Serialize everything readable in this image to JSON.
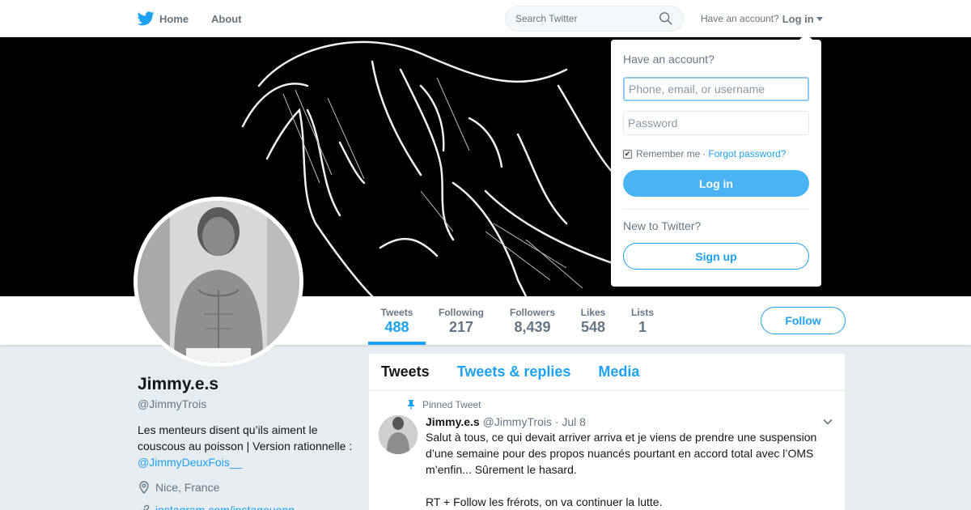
{
  "nav": {
    "home_label": "Home",
    "about_label": "About",
    "search_placeholder": "Search Twitter",
    "have_account": "Have an account?",
    "login_label": "Log in"
  },
  "profile": {
    "name": "Jimmy.e.s",
    "handle": "@JimmyTrois",
    "bio_text": "Les menteurs disent qu’ils aiment le couscous au poisson | Version rationnelle : ",
    "bio_link": "@JimmyDeuxFois__",
    "location": "Nice, France",
    "website": "instagram.com/instagouenn"
  },
  "stats": [
    {
      "label": "Tweets",
      "value": "488",
      "active": true
    },
    {
      "label": "Following",
      "value": "217"
    },
    {
      "label": "Followers",
      "value": "8,439"
    },
    {
      "label": "Likes",
      "value": "548"
    },
    {
      "label": "Lists",
      "value": "1"
    }
  ],
  "follow_label": "Follow",
  "timeline": {
    "tabs": [
      "Tweets",
      "Tweets & replies",
      "Media"
    ],
    "pinned_label": "Pinned Tweet",
    "tweet": {
      "name": "Jimmy.e.s",
      "meta": "@JimmyTrois · Jul 8",
      "text": "Salut à tous, ce qui devait arriver arriva et je viens de prendre une suspension d’une semaine pour des propos nuancés pourtant en accord total avec l’OMS m’enfin... Sûrement le hasard.",
      "text2": "RT + Follow les frérots, on va continuer la lutte."
    }
  },
  "login_dropdown": {
    "title": "Have an account?",
    "username_placeholder": "Phone, email, or username",
    "password_placeholder": "Password",
    "remember_label": "Remember me",
    "separator": "·",
    "forgot_label": "Forgot password?",
    "login_button": "Log in",
    "new_label": "New to Twitter?",
    "signup_button": "Sign up"
  },
  "colors": {
    "brand": "#1da1f2",
    "background": "#e6ecf0"
  },
  "icons": [
    "twitter-bird-icon",
    "search-icon",
    "caret-down-icon",
    "location-pin-icon",
    "link-icon",
    "pin-icon",
    "chevron-down-icon",
    "checkbox-checked-icon"
  ]
}
